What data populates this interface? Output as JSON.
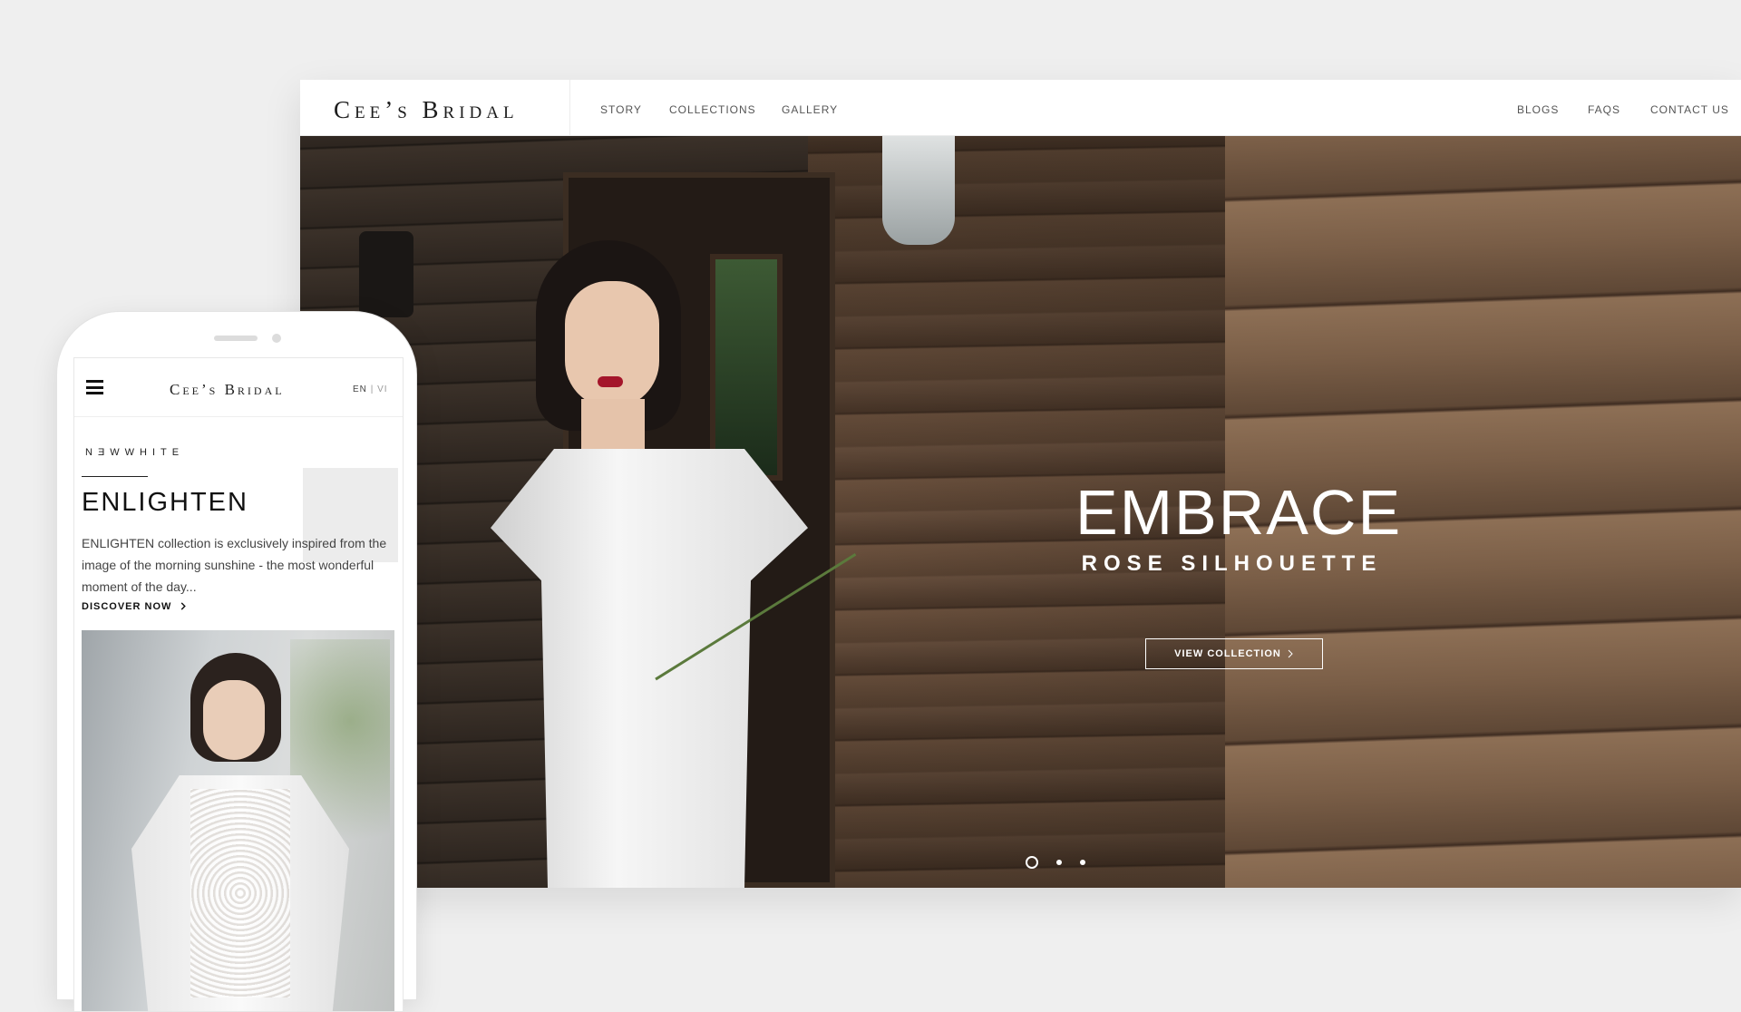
{
  "desktop": {
    "logo": "Cee’s Bridal",
    "nav_left": [
      "STORY",
      "COLLECTIONS",
      "GALLERY"
    ],
    "nav_right": [
      "BLOGS",
      "FAQS",
      "CONTACT US"
    ],
    "hero": {
      "title": "EMBRACE",
      "subtitle": "ROSE SILHOUETTE",
      "button_label": "VIEW COLLECTION",
      "slides_total": 3,
      "active_slide": 1
    }
  },
  "mobile": {
    "logo": "Cee’s Bridal",
    "lang_en": "EN",
    "lang_sep": "|",
    "lang_vi": "VI",
    "brand": "NƎWWHITE",
    "title": "ENLIGHTEN",
    "description": "ENLIGHTEN collection is exclusively inspired from the image of the morning sunshine - the most wonderful moment of the day...",
    "cta": "DISCOVER NOW"
  },
  "colors": {
    "background": "#efefef",
    "text_dark": "#111111",
    "hero_text": "#ffffff"
  },
  "icons": [
    "hamburger-menu-icon",
    "chevron-right-icon",
    "chevron-down-icon"
  ]
}
